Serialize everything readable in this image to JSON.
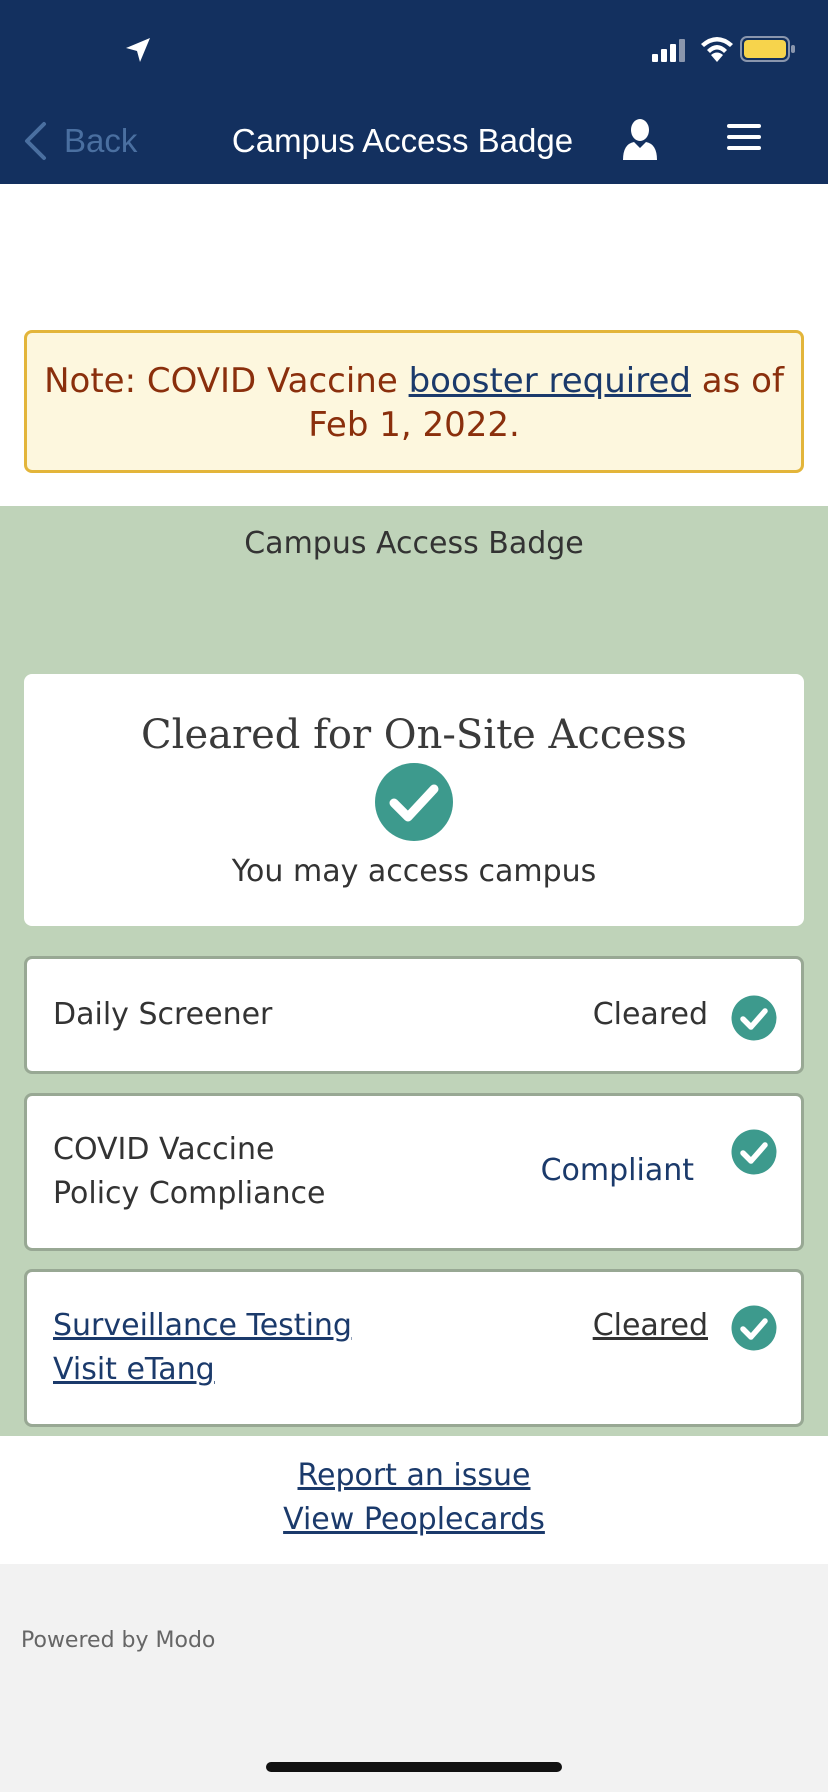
{
  "nav": {
    "back_label": "Back",
    "title": "Campus Access Badge"
  },
  "notice": {
    "prefix": "Note: COVID Vaccine ",
    "link": "booster required",
    "suffix": " as of Feb 1, 2022."
  },
  "badge": {
    "caption": "Campus Access Badge",
    "status_title": "Cleared for On-Site Access",
    "status_subtitle": "You may access campus"
  },
  "checks": [
    {
      "label": "Daily Screener",
      "value": "Cleared"
    },
    {
      "label_line1": "COVID Vaccine",
      "label_line2": "Policy Compliance",
      "value": "Compliant"
    },
    {
      "label_line1": "Surveillance Testing",
      "label_line2": "Visit eTang",
      "value": "Cleared"
    }
  ],
  "footer": {
    "report": "Report an issue",
    "peoplecards": "View Peoplecards",
    "powered": "Powered by Modo"
  },
  "colors": {
    "header": "#13305f",
    "badge_bg": "#bfd3b9",
    "check": "#3d9a8d",
    "notice_bg": "#fdf7de",
    "notice_border": "#e3b53a"
  },
  "icons": [
    "location-arrow-icon",
    "signal-icon",
    "wifi-icon",
    "battery-icon",
    "chevron-left-icon",
    "person-icon",
    "menu-icon",
    "check-circle-icon"
  ]
}
